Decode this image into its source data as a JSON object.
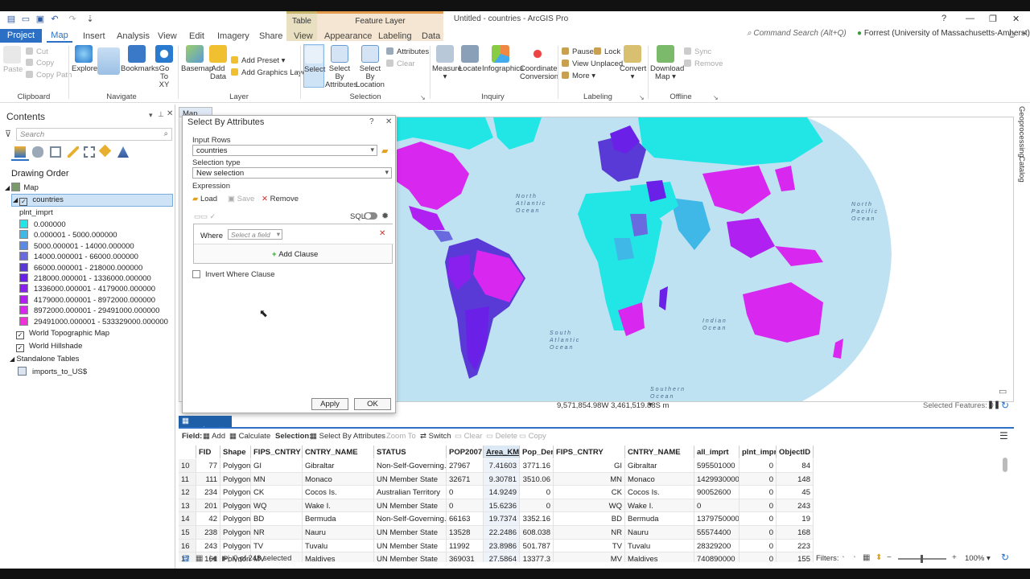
{
  "titlebar": {
    "context_table": "Table",
    "context_feature": "Feature Layer",
    "app_title": "Untitled - countries - ArcGIS Pro",
    "help": "?"
  },
  "tabs": [
    "Project",
    "Map",
    "Insert",
    "Analysis",
    "View",
    "Edit",
    "Imagery",
    "Share",
    "View",
    "Appearance",
    "Labeling",
    "Data"
  ],
  "command_search": "Command Search (Alt+Q)",
  "user": "Forrest (University of Massachusetts-Amherst)",
  "ribbon": {
    "clipboard": {
      "paste": "Paste",
      "cut": "Cut",
      "copy": "Copy",
      "copy_path": "Copy Path",
      "group": "Clipboard"
    },
    "navigate": {
      "explore": "Explore",
      "bookmarks": "Bookmarks",
      "goto1": "Go",
      "goto2": "To XY",
      "group": "Navigate"
    },
    "layer": {
      "basemap": "Basemap",
      "add_data1": "Add",
      "add_data2": "Data",
      "add_preset": "Add Preset",
      "add_graphics": "Add Graphics Layer",
      "group": "Layer"
    },
    "selection": {
      "select": "Select",
      "sba1": "Select By",
      "sba2": "Attributes",
      "sbl1": "Select By",
      "sbl2": "Location",
      "attributes": "Attributes",
      "clear": "Clear",
      "group": "Selection"
    },
    "inquiry": {
      "measure": "Measure",
      "locate": "Locate",
      "infographics": "Infographics",
      "coord1": "Coordinate",
      "coord2": "Conversion",
      "group": "Inquiry"
    },
    "labeling": {
      "pause": "Pause",
      "lock": "Lock",
      "view_unplaced": "View Unplaced",
      "more": "More",
      "group": "Labeling"
    },
    "convert": "Convert",
    "offline": {
      "download1": "Download",
      "download2": "Map",
      "sync": "Sync",
      "remove": "Remove",
      "group": "Offline"
    }
  },
  "contents": {
    "title": "Contents",
    "search_placeholder": "Search",
    "drawing_order": "Drawing Order",
    "map": "Map",
    "layer": "countries",
    "field": "plnt_imprt",
    "legend": [
      {
        "label": "0.000000",
        "color": "#22e6e6"
      },
      {
        "label": "0.000001 - 5000.000000",
        "color": "#3fb8e8"
      },
      {
        "label": "5000.000001 - 14000.000000",
        "color": "#5b8ae6"
      },
      {
        "label": "14000.000001 - 66000.000000",
        "color": "#6a6ae0"
      },
      {
        "label": "66000.000001 - 218000.000000",
        "color": "#5a3ad6"
      },
      {
        "label": "218000.000001 - 1336000.000000",
        "color": "#6a20e6"
      },
      {
        "label": "1336000.000001 - 4179000.000000",
        "color": "#8a20ee"
      },
      {
        "label": "4179000.000001 - 8972000.000000",
        "color": "#b020f0"
      },
      {
        "label": "8972000.000001 - 29491000.000000",
        "color": "#d828f0"
      },
      {
        "label": "29491000.000001 - 533329000.000000",
        "color": "#f030d8"
      }
    ],
    "topo": "World Topographic Map",
    "hillshade": "World Hillshade",
    "standalone": "Standalone Tables",
    "table": "imports_to_US$"
  },
  "map": {
    "tab": "Map",
    "labels": [
      "North Atlantic Ocean",
      "North Pacific Ocean",
      "South Atlantic Ocean",
      "Indian Ocean",
      "Southern Ocean"
    ],
    "coords": "9,571,854.98W 3,461,519.88S m",
    "selected_features": "Selected Features: 0"
  },
  "dialog": {
    "title": "Select By Attributes",
    "input_rows_label": "Input Rows",
    "input_rows": "countries",
    "selection_type_label": "Selection type",
    "selection_type": "New selection",
    "expression_label": "Expression",
    "load": "Load",
    "save": "Save",
    "remove": "Remove",
    "sql": "SQL",
    "where": "Where",
    "field_placeholder": "Select a field",
    "add_clause": "Add Clause",
    "invert": "Invert Where Clause",
    "apply": "Apply",
    "ok": "OK"
  },
  "table": {
    "tab": "countries",
    "field_label": "Field:",
    "add": "Add",
    "calculate": "Calculate",
    "selection_label": "Selection:",
    "select_by_attr": "Select By Attributes",
    "zoom_to": "Zoom To",
    "switch": "Switch",
    "clear": "Clear",
    "delete": "Delete",
    "copy": "Copy",
    "columns": [
      "FID",
      "Shape",
      "FIPS_CNTRY",
      "CNTRY_NAME",
      "STATUS",
      "POP2007",
      "Area_KM2",
      "Pop_Den",
      "FIPS_CNTRY",
      "CNTRY_NAME",
      "all_imprt",
      "plnt_imprt",
      "ObjectID *"
    ],
    "rows": [
      [
        "10",
        "77",
        "Polygon",
        "GI",
        "Gibraltar",
        "Non-Self-Governing...",
        "27967",
        "7.41603",
        "3771.16",
        "GI",
        "Gibraltar",
        "595501000",
        "0",
        "84"
      ],
      [
        "11",
        "111",
        "Polygon",
        "MN",
        "Monaco",
        "UN Member State",
        "32671",
        "9.30781",
        "3510.06",
        "MN",
        "Monaco",
        "1429930000",
        "0",
        "148"
      ],
      [
        "12",
        "234",
        "Polygon",
        "CK",
        "Cocos Is.",
        "Australian Territory",
        "0",
        "14.9249",
        "0",
        "CK",
        "Cocos Is.",
        "90052600",
        "0",
        "45"
      ],
      [
        "13",
        "201",
        "Polygon",
        "WQ",
        "Wake I.",
        "UN Member State",
        "0",
        "15.6236",
        "0",
        "WQ",
        "Wake I.",
        "0",
        "0",
        "243"
      ],
      [
        "14",
        "42",
        "Polygon",
        "BD",
        "Bermuda",
        "Non-Self-Governing...",
        "66163",
        "19.7374",
        "3352.16",
        "BD",
        "Bermuda",
        "13797500000",
        "0",
        "19"
      ],
      [
        "15",
        "238",
        "Polygon",
        "NR",
        "Nauru",
        "UN Member State",
        "13528",
        "22.2486",
        "608.038",
        "NR",
        "Nauru",
        "55574400",
        "0",
        "168"
      ],
      [
        "16",
        "243",
        "Polygon",
        "TV",
        "Tuvalu",
        "UN Member State",
        "11992",
        "23.8986",
        "501.787",
        "TV",
        "Tuvalu",
        "28329200",
        "0",
        "223"
      ],
      [
        "17",
        "161",
        "Polygon",
        "MV",
        "Maldives",
        "UN Member State",
        "369031",
        "27.5864",
        "13377.3",
        "MV",
        "Maldives",
        "740890000",
        "0",
        "155"
      ]
    ],
    "selected": "0 of 248 selected",
    "filters": "Filters:",
    "zoom": "100%"
  },
  "right_rail": {
    "geoprocessing": "Geoprocessing",
    "catalog": "Catalog"
  }
}
